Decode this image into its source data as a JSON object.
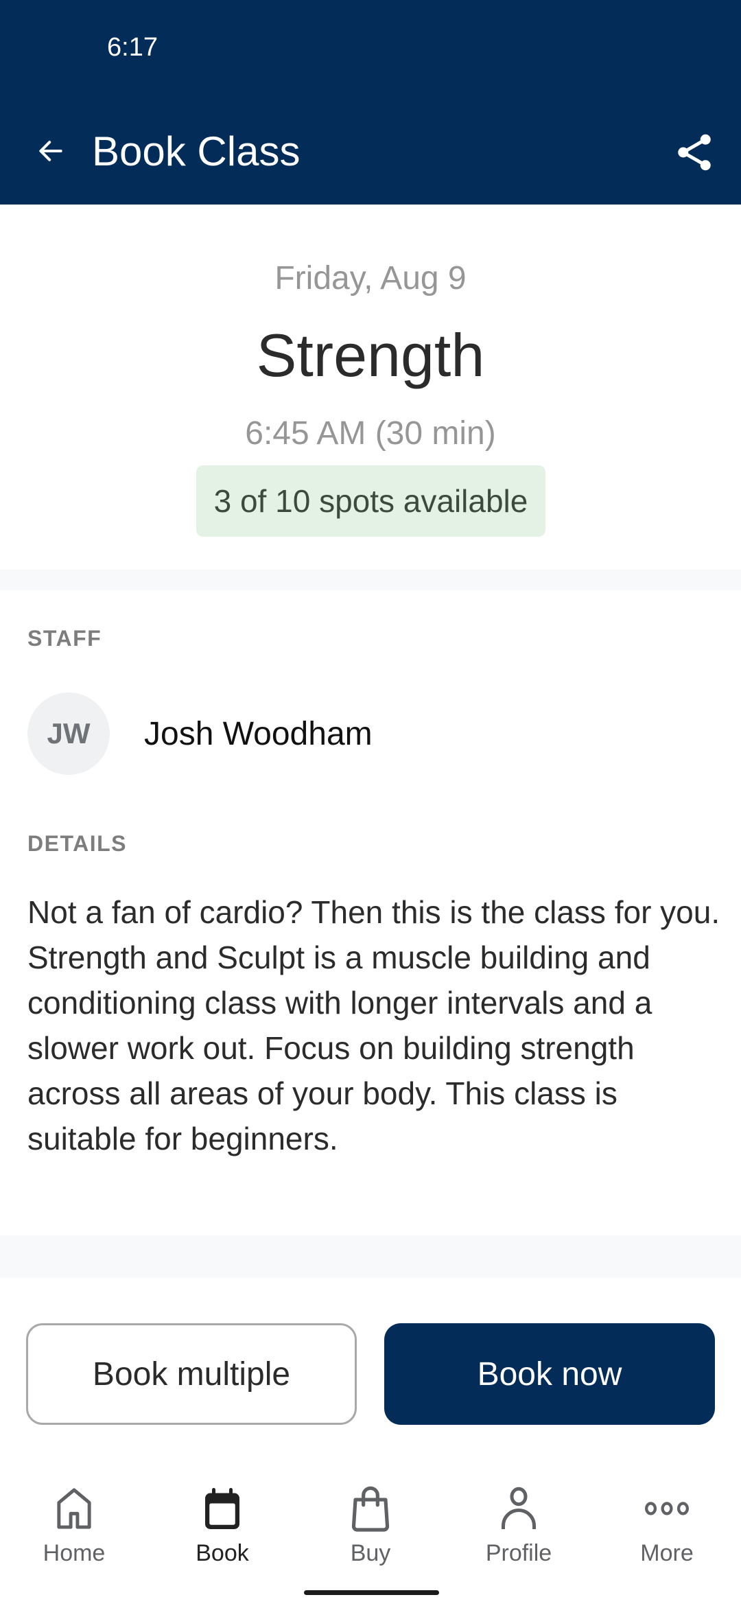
{
  "status_bar": {
    "time": "6:17"
  },
  "app_bar": {
    "title": "Book Class",
    "back_icon": "arrow-left-icon",
    "share_icon": "share-icon"
  },
  "class_info": {
    "date": "Friday, Aug 9",
    "name": "Strength",
    "time": "6:45 AM (30 min)",
    "availability": "3 of 10 spots available",
    "spots_available": 3,
    "spots_total": 10
  },
  "staff": {
    "section_label": "STAFF",
    "initials": "JW",
    "name": "Josh Woodham"
  },
  "details": {
    "section_label": "DETAILS",
    "text": "Not a fan of cardio? Then this is the class for you. Strength and Sculpt is a muscle building and conditioning class with longer intervals and a slower work out. Focus on building strength across all areas of your body. This class is suitable for beginners."
  },
  "actions": {
    "book_multiple": "Book multiple",
    "book_now": "Book now"
  },
  "bottom_nav": {
    "items": [
      {
        "label": "Home",
        "icon": "home-icon",
        "active": false
      },
      {
        "label": "Book",
        "icon": "calendar-icon",
        "active": true
      },
      {
        "label": "Buy",
        "icon": "shopping-bag-icon",
        "active": false
      },
      {
        "label": "Profile",
        "icon": "person-icon",
        "active": false
      },
      {
        "label": "More",
        "icon": "more-dots-icon",
        "active": false
      }
    ]
  },
  "colors": {
    "brand_primary": "#032d58",
    "availability_bg": "#e3f2e4",
    "muted_text": "#969696"
  }
}
